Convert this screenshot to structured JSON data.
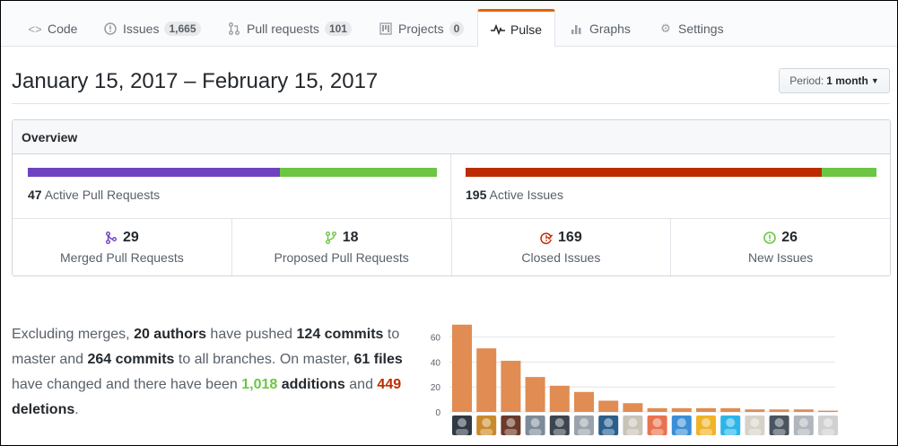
{
  "tabs": [
    {
      "label": "Code",
      "icon": "code-icon",
      "counter": ""
    },
    {
      "label": "Issues",
      "icon": "issue-icon",
      "counter": "1,665"
    },
    {
      "label": "Pull requests",
      "icon": "pull-request-icon",
      "counter": "101"
    },
    {
      "label": "Projects",
      "icon": "project-icon",
      "counter": "0"
    },
    {
      "label": "Pulse",
      "icon": "pulse-icon",
      "counter": ""
    },
    {
      "label": "Graphs",
      "icon": "graph-icon",
      "counter": ""
    },
    {
      "label": "Settings",
      "icon": "gear-icon",
      "counter": ""
    }
  ],
  "header": {
    "date_range": "January 15, 2017 – February 15, 2017",
    "period_label": "Period:",
    "period_value": "1 month"
  },
  "overview": {
    "title": "Overview",
    "pull_requests": {
      "count": "47",
      "label": "Active Pull Requests",
      "merged_fraction": 0.617
    },
    "issues": {
      "count": "195",
      "label": "Active Issues",
      "closed_fraction": 0.867
    },
    "stats": [
      {
        "value": "29",
        "label": "Merged Pull Requests",
        "icon": "merge-icon",
        "color": "#6f42c1"
      },
      {
        "value": "18",
        "label": "Proposed Pull Requests",
        "icon": "pull-request-icon",
        "color": "#6cc644"
      },
      {
        "value": "169",
        "label": "Closed Issues",
        "icon": "issue-closed-icon",
        "color": "#bd2c00"
      },
      {
        "value": "26",
        "label": "New Issues",
        "icon": "issue-opened-icon",
        "color": "#6cc644"
      }
    ]
  },
  "summary": {
    "t1": "Excluding merges, ",
    "authors": "20 authors",
    "t2": " have pushed ",
    "commits_master": "124 commits",
    "t3": " to master and ",
    "commits_all": "264 commits",
    "t4": " to all branches. On master, ",
    "files": "61 files",
    "t5": " have changed and there have been ",
    "additions": "1,018",
    "t6": " additions",
    "t7": " and ",
    "deletions": "449",
    "t8": " deletions",
    "t9": "."
  },
  "colors": {
    "purple": "#6f42c1",
    "green": "#6cc644",
    "red": "#bd2c00",
    "bar": "#e08c52",
    "accent": "#e36209"
  },
  "chart_data": {
    "type": "bar",
    "categories": [
      "author-1",
      "author-2",
      "author-3",
      "author-4",
      "author-5",
      "author-6",
      "author-7",
      "author-8",
      "author-9",
      "author-10",
      "author-11",
      "author-12",
      "author-13",
      "author-14",
      "author-15",
      "author-16"
    ],
    "values": [
      70,
      51,
      41,
      28,
      21,
      16,
      9,
      7,
      3,
      3,
      3,
      3,
      2,
      2,
      2,
      1
    ],
    "yticks": [
      0,
      20,
      40,
      60
    ],
    "ylim": [
      0,
      72
    ],
    "grid": true,
    "avatar_colors": [
      "#2f3a45",
      "#c98a2b",
      "#6b3a2a",
      "#7d8a99",
      "#3d4650",
      "#9aa3ab",
      "#2b5f8c",
      "#c9c3b8",
      "#e8734f",
      "#3c8fd6",
      "#f0b429",
      "#2cb5e8",
      "#d7d2c9",
      "#4a5560",
      "#b0b6bc",
      "#d0d0d0"
    ]
  }
}
